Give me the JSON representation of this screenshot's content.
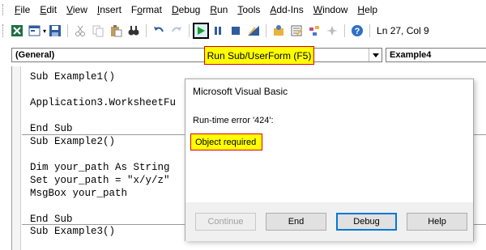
{
  "menu": {
    "items": [
      {
        "pre": "",
        "key": "F",
        "post": "ile"
      },
      {
        "pre": "",
        "key": "E",
        "post": "dit"
      },
      {
        "pre": "",
        "key": "V",
        "post": "iew"
      },
      {
        "pre": "",
        "key": "I",
        "post": "nsert"
      },
      {
        "pre": "F",
        "key": "o",
        "post": "rmat"
      },
      {
        "pre": "",
        "key": "D",
        "post": "ebug"
      },
      {
        "pre": "",
        "key": "R",
        "post": "un"
      },
      {
        "pre": "",
        "key": "T",
        "post": "ools"
      },
      {
        "pre": "",
        "key": "A",
        "post": "dd-Ins"
      },
      {
        "pre": "",
        "key": "W",
        "post": "indow"
      },
      {
        "pre": "",
        "key": "H",
        "post": "elp"
      }
    ]
  },
  "toolbar": {
    "status": "Ln 27, Col 9",
    "tooltip": "Run Sub/UserForm (F5)"
  },
  "combos": {
    "object": "(General)",
    "procedure": "Example4"
  },
  "code": {
    "lines": [
      "Sub Example1()",
      "Application3.WorksheetFu",
      "End Sub",
      "Sub Example2()",
      "Dim your_path As String",
      "Set your_path = \"x/y/z\"",
      "MsgBox your_path",
      "End Sub",
      "Sub Example3()"
    ]
  },
  "dialog": {
    "title": "Microsoft Visual Basic",
    "message": "Run-time error '424':",
    "detail": "Object required",
    "buttons": {
      "continue": "Continue",
      "end": "End",
      "debug": "Debug",
      "help": "Help"
    }
  }
}
